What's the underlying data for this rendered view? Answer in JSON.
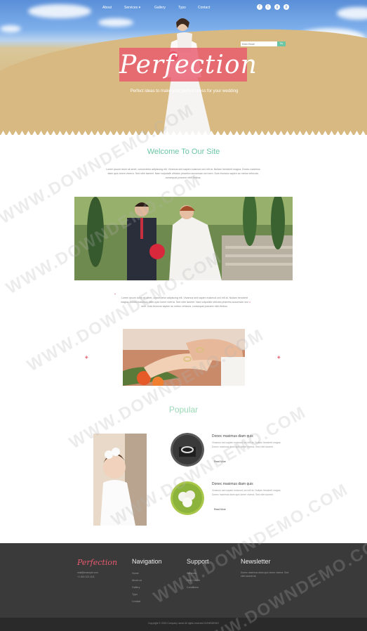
{
  "nav": {
    "items": [
      "About",
      "Services",
      "Gallery",
      "Typo",
      "Contact"
    ],
    "services_caret": "▾",
    "social": [
      "f",
      "t",
      "g",
      "p"
    ]
  },
  "hero": {
    "logo": "Perfection",
    "tagline": "Perfect ideas to make your perfect dress for your wedding"
  },
  "welcome": {
    "title": "Welcome To Our Site",
    "text": "Lorem ipsum dolor sit amet, consectetur adipiscing elit. Vivamus sed sapien euismod orci elit at. Nullam hendrerit magna. Donec maximus diam quis lorem viverra. Sed nibh laoreet. Nam vulputate ultricies pharetra accumsan orci sem. Duis thoncus sapien ac metus vehicula, consequat posuere nibh finibus.",
    "text2": "Lorem ipsum dolor sit amet, consectetur adipiscing elit. Vivamus sed sapien euismod orci elit at. Nullam hendrerit magna. Donec maximus diam quis lorem viverra. Sed nibh laoreet. Nam vulputate ultricies pharetra accumsan orci sem. Duis thoncus sapien ac metus vehicula, consequat posuere nibh finibus."
  },
  "popular": {
    "title": "Popular",
    "items": [
      {
        "title": "Donec maximus diam quis",
        "text": "Vivamus sed sapien euismod orci elit at. Nullam hendrerit magna. Donec maximus diam quis lorem viverra. Sed nibh laoreet.",
        "link": "Read More"
      },
      {
        "title": "Donec maximus diam quis",
        "text": "Vivamus sed sapien euismod orci elit at. Nullam hendrerit magna. Donec maximus diam quis lorem viverra. Sed nibh laoreet.",
        "link": "Read More"
      }
    ]
  },
  "footer": {
    "logo": "Perfection",
    "email": "mail@example.com",
    "phone": "+1 800 123 1111",
    "nav_title": "Navigation",
    "nav_links": [
      "Home",
      "About us",
      "Gallery",
      "Typo",
      "Contact"
    ],
    "support_title": "Support",
    "support_links": [
      "Services",
      "Help Center",
      "Conditions"
    ],
    "newsletter_title": "Newsletter",
    "newsletter_text": "Donec maximus diam quis lorem viverra. Sed nibh laoreet at.",
    "newsletter_placeholder": "Enter Email",
    "newsletter_button": "Go",
    "copyright": "Copyright © 2015 Company name All rights reserved DOWNDEMO"
  },
  "watermark": "WWW.DOWNDEMO.COM",
  "colors": {
    "accent_pink": "#e85a6e",
    "accent_green": "#6cc6a4",
    "footer_bg": "#3a3a3a"
  }
}
